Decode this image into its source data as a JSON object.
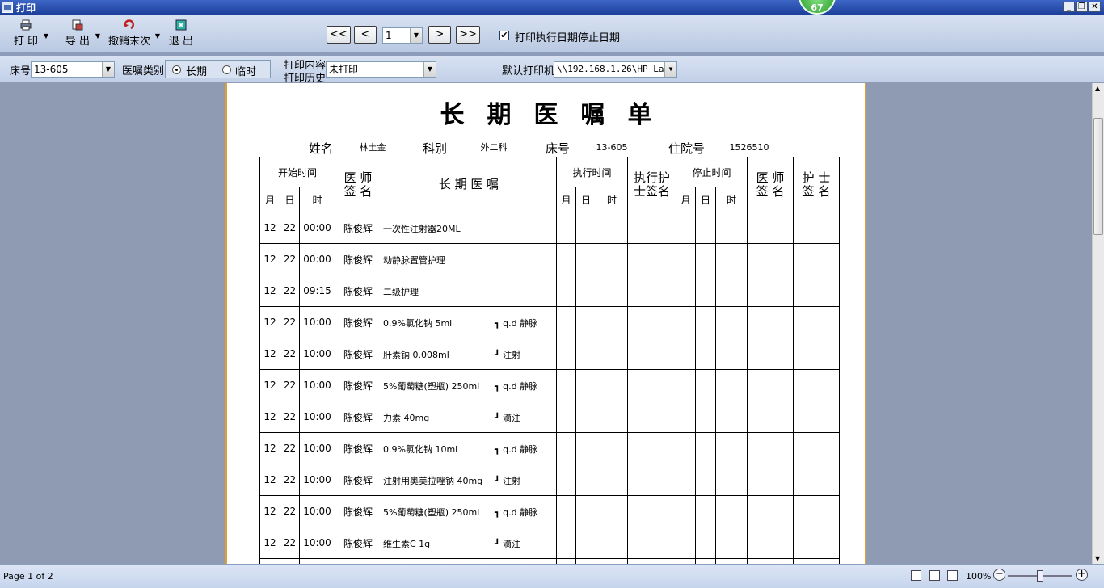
{
  "window": {
    "title": "打印",
    "badge": "67"
  },
  "toolbar": {
    "print_label": "打 印",
    "export_label": "导 出",
    "undo_label": "撤销末次",
    "exit_label": "退 出",
    "first_page": "<<",
    "prev_page": "<",
    "page_value": "1",
    "next_page": ">",
    "last_page": ">>",
    "print_dates_label": "打印执行日期停止日期",
    "print_dates_checked": true
  },
  "filter": {
    "bed_label": "床号",
    "bed_value": "13-605",
    "order_type_label": "医嘱类别",
    "order_type_long": "长期",
    "order_type_temp": "临时",
    "print_content_label": "打印内容",
    "print_history_label": "打印历史",
    "print_content_value": "未打印",
    "printer_label": "默认打印机",
    "printer_value": "\\\\192.168.1.26\\HP La"
  },
  "sheet": {
    "title": "长期医嘱单",
    "name_label": "姓名",
    "name_value": "林土金",
    "dept_label": "科别",
    "dept_value": "外二科",
    "bed_label": "床号",
    "bed_value": "13-605",
    "admission_label": "住院号",
    "admission_value": "1526510",
    "headers": {
      "start_time": "开始时间",
      "doctor_sign": "医 师 签 名",
      "long_order": "长 期 医 嘱",
      "exec_time": "执行时间",
      "exec_nurse_sign": "执行护士签名",
      "stop_time": "停止时间",
      "doctor_sign2": "医 师 签 名",
      "nurse_sign": "护 士 签 名",
      "month": "月",
      "day": "日",
      "hour": "时"
    },
    "rows": [
      {
        "month": "12",
        "day": "22",
        "time": "00:00",
        "doctor": "陈俊辉",
        "order": "一次性注射器20ML",
        "route": ""
      },
      {
        "month": "12",
        "day": "22",
        "time": "00:00",
        "doctor": "陈俊辉",
        "order": "动静脉置管护理",
        "route": ""
      },
      {
        "month": "12",
        "day": "22",
        "time": "09:15",
        "doctor": "陈俊辉",
        "order": "二级护理",
        "route": ""
      },
      {
        "month": "12",
        "day": "22",
        "time": "10:00",
        "doctor": "陈俊辉",
        "order": "0.9%氯化钠 5ml",
        "route": "┓ q.d 静脉"
      },
      {
        "month": "12",
        "day": "22",
        "time": "10:00",
        "doctor": "陈俊辉",
        "order": "肝素钠 0.008ml",
        "route": "┛ 注射"
      },
      {
        "month": "12",
        "day": "22",
        "time": "10:00",
        "doctor": "陈俊辉",
        "order": "5%葡萄糖(塑瓶) 250ml",
        "route": "┓ q.d 静脉"
      },
      {
        "month": "12",
        "day": "22",
        "time": "10:00",
        "doctor": "陈俊辉",
        "order": "力素 40mg",
        "route": "┛ 滴注"
      },
      {
        "month": "12",
        "day": "22",
        "time": "10:00",
        "doctor": "陈俊辉",
        "order": "0.9%氯化钠 10ml",
        "route": "┓ q.d 静脉"
      },
      {
        "month": "12",
        "day": "22",
        "time": "10:00",
        "doctor": "陈俊辉",
        "order": "注射用奥美拉唑钠 40mg",
        "route": "┛ 注射"
      },
      {
        "month": "12",
        "day": "22",
        "time": "10:00",
        "doctor": "陈俊辉",
        "order": "5%葡萄糖(塑瓶) 250ml",
        "route": "┓ q.d 静脉"
      },
      {
        "month": "12",
        "day": "22",
        "time": "10:00",
        "doctor": "陈俊辉",
        "order": "维生素C 1g",
        "route": "┛ 滴注"
      },
      {
        "month": "",
        "day": "",
        "time": "",
        "doctor": "",
        "order": "",
        "route": ""
      }
    ]
  },
  "status": {
    "page_text": "Page 1 of 2",
    "zoom": "100%"
  }
}
